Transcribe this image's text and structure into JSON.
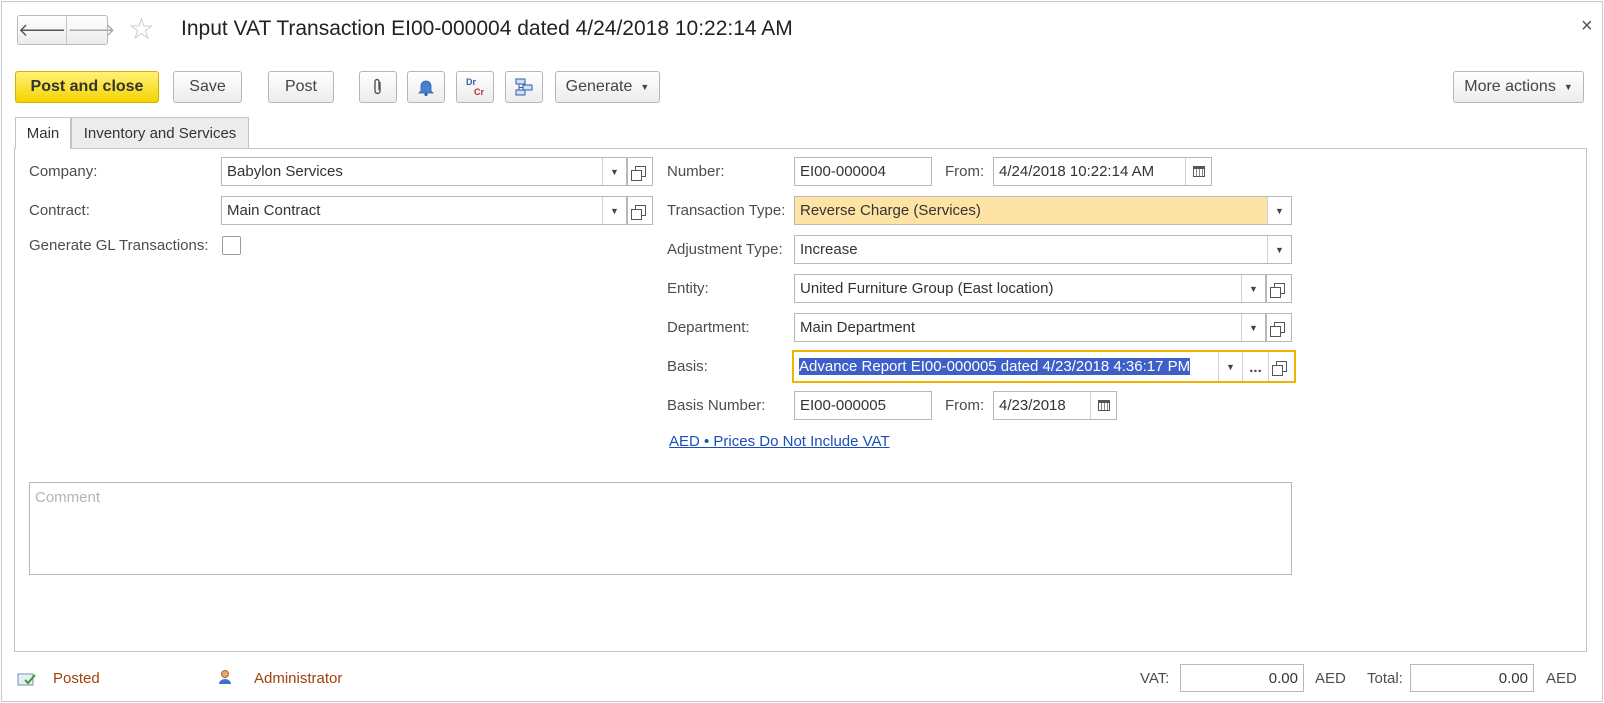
{
  "window": {
    "title": "Input VAT Transaction EI00-000004 dated 4/24/2018 10:22:14 AM",
    "close": "×"
  },
  "nav": {
    "back": "🡐",
    "forward": "🡒",
    "star": "☆"
  },
  "toolbar": {
    "post_and_close": "Post and close",
    "save": "Save",
    "post": "Post",
    "generate": "Generate",
    "more_actions": "More actions",
    "drcr_top": "Dr",
    "drcr_bottom": "Cr"
  },
  "tabs": [
    {
      "label": "Main"
    },
    {
      "label": "Inventory and Services"
    }
  ],
  "form": {
    "company_label": "Company:",
    "company_value": "Babylon Services",
    "contract_label": "Contract:",
    "contract_value": "Main Contract",
    "gl_label": "Generate GL Transactions:",
    "number_label": "Number:",
    "number_value": "EI00-000004",
    "from_label": "From:",
    "from_value": "4/24/2018 10:22:14 AM",
    "transaction_type_label": "Transaction Type:",
    "transaction_type_value": "Reverse Charge (Services)",
    "adjustment_type_label": "Adjustment Type:",
    "adjustment_type_value": "Increase",
    "entity_label": "Entity:",
    "entity_value": "United Furniture Group (East location)",
    "department_label": "Department:",
    "department_value": "Main Department",
    "basis_label": "Basis:",
    "basis_value": "Advance Report EI00-000005 dated 4/23/2018 4:36:17 PM",
    "basis_dots": "...",
    "basis_number_label": "Basis Number:",
    "basis_number_value": "EI00-000005",
    "basis_from_label": "From:",
    "basis_from_value": "4/23/2018",
    "prices_link": "AED • Prices Do Not Include VAT",
    "comment_placeholder": "Comment"
  },
  "footer": {
    "status": "Posted",
    "user": "Administrator",
    "vat_label": "VAT:",
    "vat_value": "0.00",
    "vat_currency": "AED",
    "total_label": "Total:",
    "total_value": "0.00",
    "total_currency": "AED"
  },
  "colors": {
    "primary_button": "#f5d400",
    "transaction_type_bg": "#fde3a4",
    "basis_focus_border": "#f0b400",
    "basis_selection": "#3d5fc7",
    "status_text": "#a0420a",
    "link": "#1a4fb8"
  }
}
